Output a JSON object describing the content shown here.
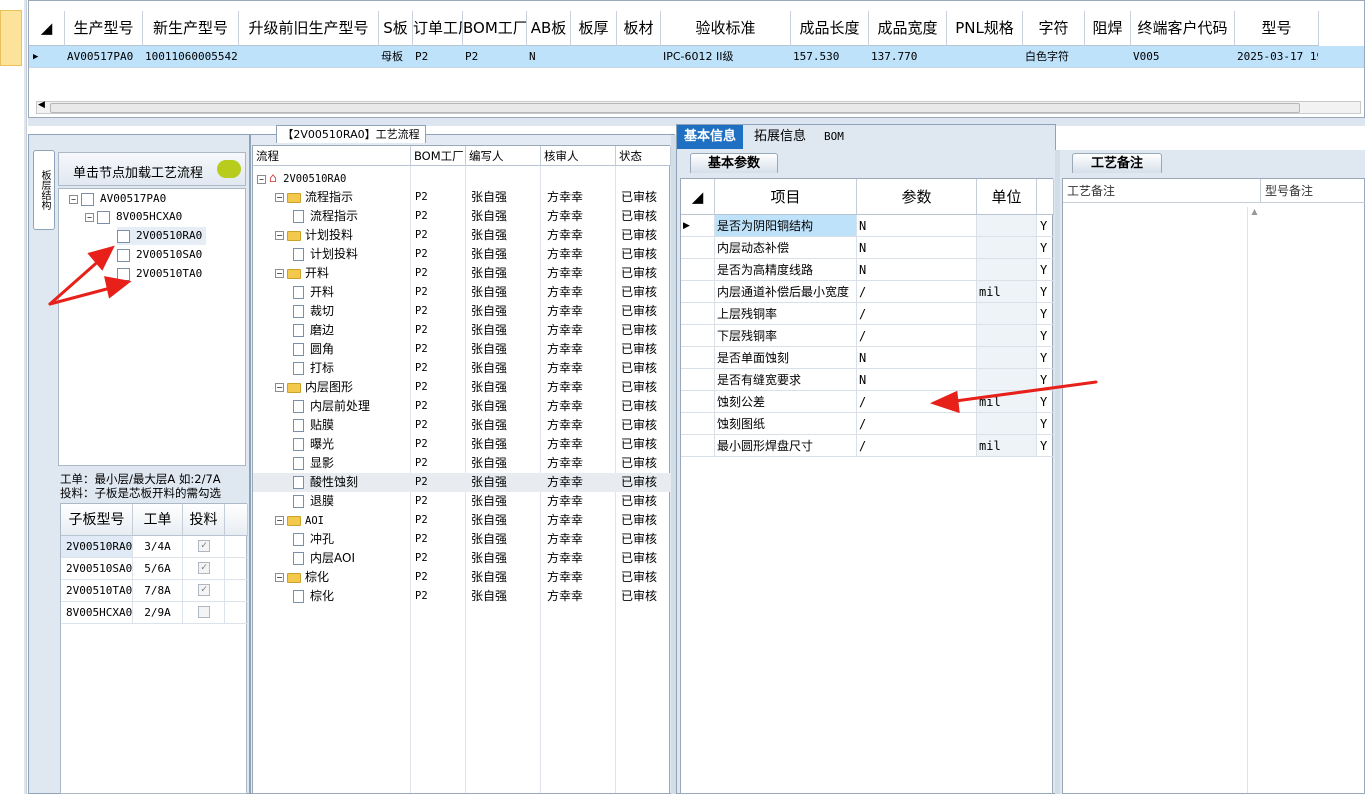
{
  "top_grid": {
    "columns": [
      "生产型号",
      "新生产型号",
      "升级前旧生产型号",
      "S板",
      "订单工厂",
      "BOM工厂",
      "AB板",
      "板厚",
      "板材",
      "验收标准",
      "成品长度",
      "成品宽度",
      "PNL规格",
      "字符",
      "阻焊",
      "终端客户代码",
      "型号"
    ],
    "row": [
      "AV00517PA0",
      "10011060005542",
      "",
      "母板",
      "P2",
      "P2",
      "N",
      "",
      "",
      "IPC-6012 II级",
      "157.530",
      "137.770",
      "",
      "白色字符",
      "",
      "V005",
      "2025-03-17 19:"
    ]
  },
  "left_panel": {
    "vertical_tab": "板层结构",
    "hint": "单击节点加载工艺流程",
    "tree": [
      "AV00517PA0",
      "8V005HCXA0",
      "2V00510RA0",
      "2V00510SA0",
      "2V00510TA0"
    ],
    "note_line1": "工单：最小层/最大层A 如:2/7A",
    "note_line2": "投料：子板是芯板开料的需勾选",
    "sub_headers": [
      "子板型号",
      "工单",
      "投料"
    ],
    "sub_rows": [
      {
        "model": "2V00510RA0",
        "order": "3/4A",
        "feed": "✓"
      },
      {
        "model": "2V00510SA0",
        "order": "5/6A",
        "feed": "✓"
      },
      {
        "model": "2V00510TA0",
        "order": "7/8A",
        "feed": "✓"
      },
      {
        "model": "8V005HCXA0",
        "order": "2/9A",
        "feed": ""
      }
    ]
  },
  "flow": {
    "title": "【2V00510RA0】工艺流程",
    "headers": [
      "流程",
      "BOM工厂",
      "编写人",
      "核审人",
      "状态"
    ],
    "root": "2V00510RA0",
    "rows": [
      {
        "name": "流程指示",
        "level": 1,
        "folder": true,
        "bom": "P2",
        "writer": "张自强",
        "reviewer": "方幸幸",
        "status": "已审核"
      },
      {
        "name": "流程指示",
        "level": 2,
        "folder": false,
        "bom": "P2",
        "writer": "张自强",
        "reviewer": "方幸幸",
        "status": "已审核"
      },
      {
        "name": "计划投料",
        "level": 1,
        "folder": true,
        "bom": "P2",
        "writer": "张自强",
        "reviewer": "方幸幸",
        "status": "已审核"
      },
      {
        "name": "计划投料",
        "level": 2,
        "folder": false,
        "bom": "P2",
        "writer": "张自强",
        "reviewer": "方幸幸",
        "status": "已审核"
      },
      {
        "name": "开料",
        "level": 1,
        "folder": true,
        "bom": "P2",
        "writer": "张自强",
        "reviewer": "方幸幸",
        "status": "已审核"
      },
      {
        "name": "开料",
        "level": 2,
        "folder": false,
        "bom": "P2",
        "writer": "张自强",
        "reviewer": "方幸幸",
        "status": "已审核"
      },
      {
        "name": "裁切",
        "level": 2,
        "folder": false,
        "bom": "P2",
        "writer": "张自强",
        "reviewer": "方幸幸",
        "status": "已审核"
      },
      {
        "name": "磨边",
        "level": 2,
        "folder": false,
        "bom": "P2",
        "writer": "张自强",
        "reviewer": "方幸幸",
        "status": "已审核"
      },
      {
        "name": "圆角",
        "level": 2,
        "folder": false,
        "bom": "P2",
        "writer": "张自强",
        "reviewer": "方幸幸",
        "status": "已审核"
      },
      {
        "name": "打标",
        "level": 2,
        "folder": false,
        "bom": "P2",
        "writer": "张自强",
        "reviewer": "方幸幸",
        "status": "已审核"
      },
      {
        "name": "内层图形",
        "level": 1,
        "folder": true,
        "bom": "P2",
        "writer": "张自强",
        "reviewer": "方幸幸",
        "status": "已审核"
      },
      {
        "name": "内层前处理",
        "level": 2,
        "folder": false,
        "bom": "P2",
        "writer": "张自强",
        "reviewer": "方幸幸",
        "status": "已审核"
      },
      {
        "name": "贴膜",
        "level": 2,
        "folder": false,
        "bom": "P2",
        "writer": "张自强",
        "reviewer": "方幸幸",
        "status": "已审核"
      },
      {
        "name": "曝光",
        "level": 2,
        "folder": false,
        "bom": "P2",
        "writer": "张自强",
        "reviewer": "方幸幸",
        "status": "已审核"
      },
      {
        "name": "显影",
        "level": 2,
        "folder": false,
        "bom": "P2",
        "writer": "张自强",
        "reviewer": "方幸幸",
        "status": "已审核"
      },
      {
        "name": "酸性蚀刻",
        "level": 2,
        "folder": false,
        "bom": "P2",
        "writer": "张自强",
        "reviewer": "方幸幸",
        "status": "已审核",
        "selected": true
      },
      {
        "name": "退膜",
        "level": 2,
        "folder": false,
        "bom": "P2",
        "writer": "张自强",
        "reviewer": "方幸幸",
        "status": "已审核"
      },
      {
        "name": "AOI",
        "level": 1,
        "folder": true,
        "bom": "P2",
        "writer": "张自强",
        "reviewer": "方幸幸",
        "status": "已审核"
      },
      {
        "name": "冲孔",
        "level": 2,
        "folder": false,
        "bom": "P2",
        "writer": "张自强",
        "reviewer": "方幸幸",
        "status": "已审核"
      },
      {
        "name": "内层AOI",
        "level": 2,
        "folder": false,
        "bom": "P2",
        "writer": "张自强",
        "reviewer": "方幸幸",
        "status": "已审核"
      },
      {
        "name": "棕化",
        "level": 1,
        "folder": true,
        "bom": "P2",
        "writer": "张自强",
        "reviewer": "方幸幸",
        "status": "已审核"
      },
      {
        "name": "棕化",
        "level": 2,
        "folder": false,
        "bom": "P2",
        "writer": "张自强",
        "reviewer": "方幸幸",
        "status": "已审核"
      }
    ]
  },
  "tabs": [
    "基本信息",
    "拓展信息",
    "BOM"
  ],
  "params": {
    "section_title": "基本参数",
    "headers": [
      "项目",
      "参数",
      "单位"
    ],
    "rows": [
      {
        "item": "是否为阴阳铜结构",
        "value": "N",
        "unit": "",
        "flag": "Y"
      },
      {
        "item": "内层动态补偿",
        "value": "N",
        "unit": "",
        "flag": "Y"
      },
      {
        "item": "是否为高精度线路",
        "value": "N",
        "unit": "",
        "flag": "Y"
      },
      {
        "item": "内层通道补偿后最小宽度",
        "value": "/",
        "unit": "mil",
        "flag": "Y"
      },
      {
        "item": "上层残铜率",
        "value": "/",
        "unit": "",
        "flag": "Y"
      },
      {
        "item": "下层残铜率",
        "value": "/",
        "unit": "",
        "flag": "Y"
      },
      {
        "item": "是否单面蚀刻",
        "value": "N",
        "unit": "",
        "flag": "Y"
      },
      {
        "item": "是否有缝宽要求",
        "value": "N",
        "unit": "",
        "flag": "Y"
      },
      {
        "item": "蚀刻公差",
        "value": "/",
        "unit": "mil",
        "flag": "Y"
      },
      {
        "item": "蚀刻图纸",
        "value": "/",
        "unit": "",
        "flag": "Y"
      },
      {
        "item": "最小圆形焊盘尺寸",
        "value": "/",
        "unit": "mil",
        "flag": "Y"
      }
    ]
  },
  "remarks": {
    "section_title": "工艺备注",
    "headers": [
      "工艺备注",
      "型号备注"
    ]
  },
  "colors": {
    "annotation_arrow": "#e8201a",
    "selected_row": "#bfe2fb",
    "tab_active": "#1f6fc3"
  }
}
